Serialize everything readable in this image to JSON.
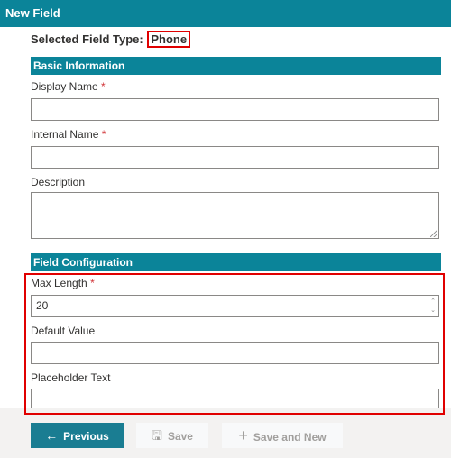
{
  "window": {
    "title": "New Field"
  },
  "field_type": {
    "label": "Selected Field Type:",
    "value": "Phone"
  },
  "sections": {
    "basic": {
      "title": "Basic Information"
    },
    "config": {
      "title": "Field Configuration"
    }
  },
  "fields": {
    "display_name": {
      "label": "Display Name",
      "required_mark": "*",
      "value": ""
    },
    "internal_name": {
      "label": "Internal Name",
      "required_mark": "*",
      "value": ""
    },
    "description": {
      "label": "Description",
      "value": ""
    },
    "max_length": {
      "label": "Max Length",
      "required_mark": "*",
      "value": "20"
    },
    "default_value": {
      "label": "Default Value",
      "value": ""
    },
    "placeholder_text": {
      "label": "Placeholder Text",
      "value": ""
    }
  },
  "buttons": {
    "previous": {
      "label": "Previous",
      "icon": "arrow-left-icon",
      "glyph": "←"
    },
    "save": {
      "label": "Save",
      "icon": "save-icon",
      "glyph": "🖫"
    },
    "save_and_new": {
      "label": "Save and New",
      "icon": "plus-icon",
      "glyph": "+"
    }
  }
}
